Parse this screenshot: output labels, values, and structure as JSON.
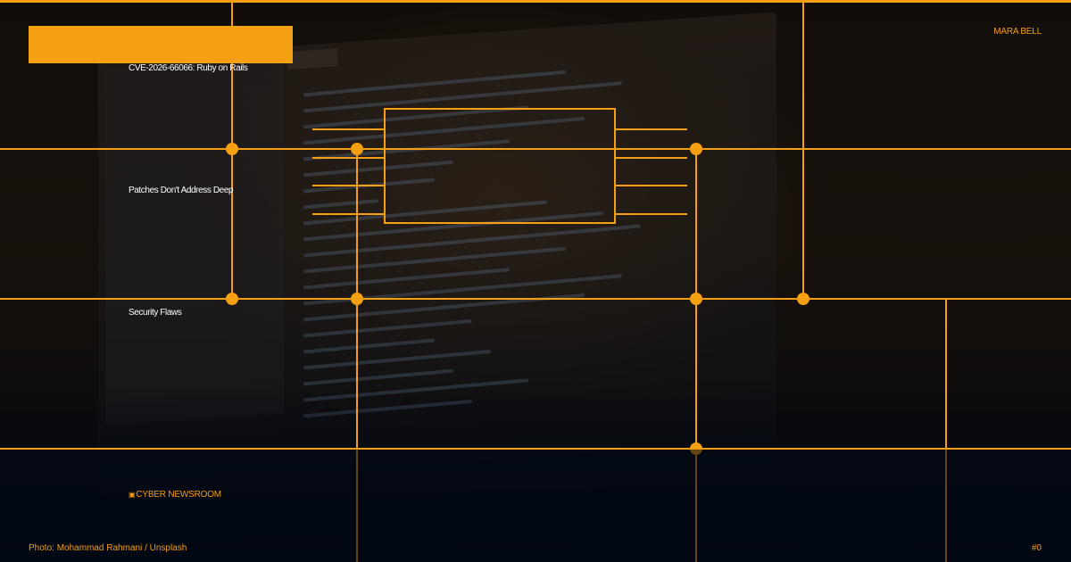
{
  "card": {
    "headline_lines": [
      "CVE-2026-66066: Ruby on Rails",
      "Patches Don't Address Deep",
      "Security Flaws"
    ],
    "author": "MARA BELL",
    "brand_icon": "shield-icon",
    "brand": "CYBER NEWSROOM",
    "photo_credit": "Photo: Mohammad Rahmani / Unsplash",
    "page_number": "#0"
  },
  "colors": {
    "accent": "#f59f12",
    "background_dark": "#0d0a08",
    "background_bottom": "#030813",
    "headline_text": "#ffffff"
  }
}
